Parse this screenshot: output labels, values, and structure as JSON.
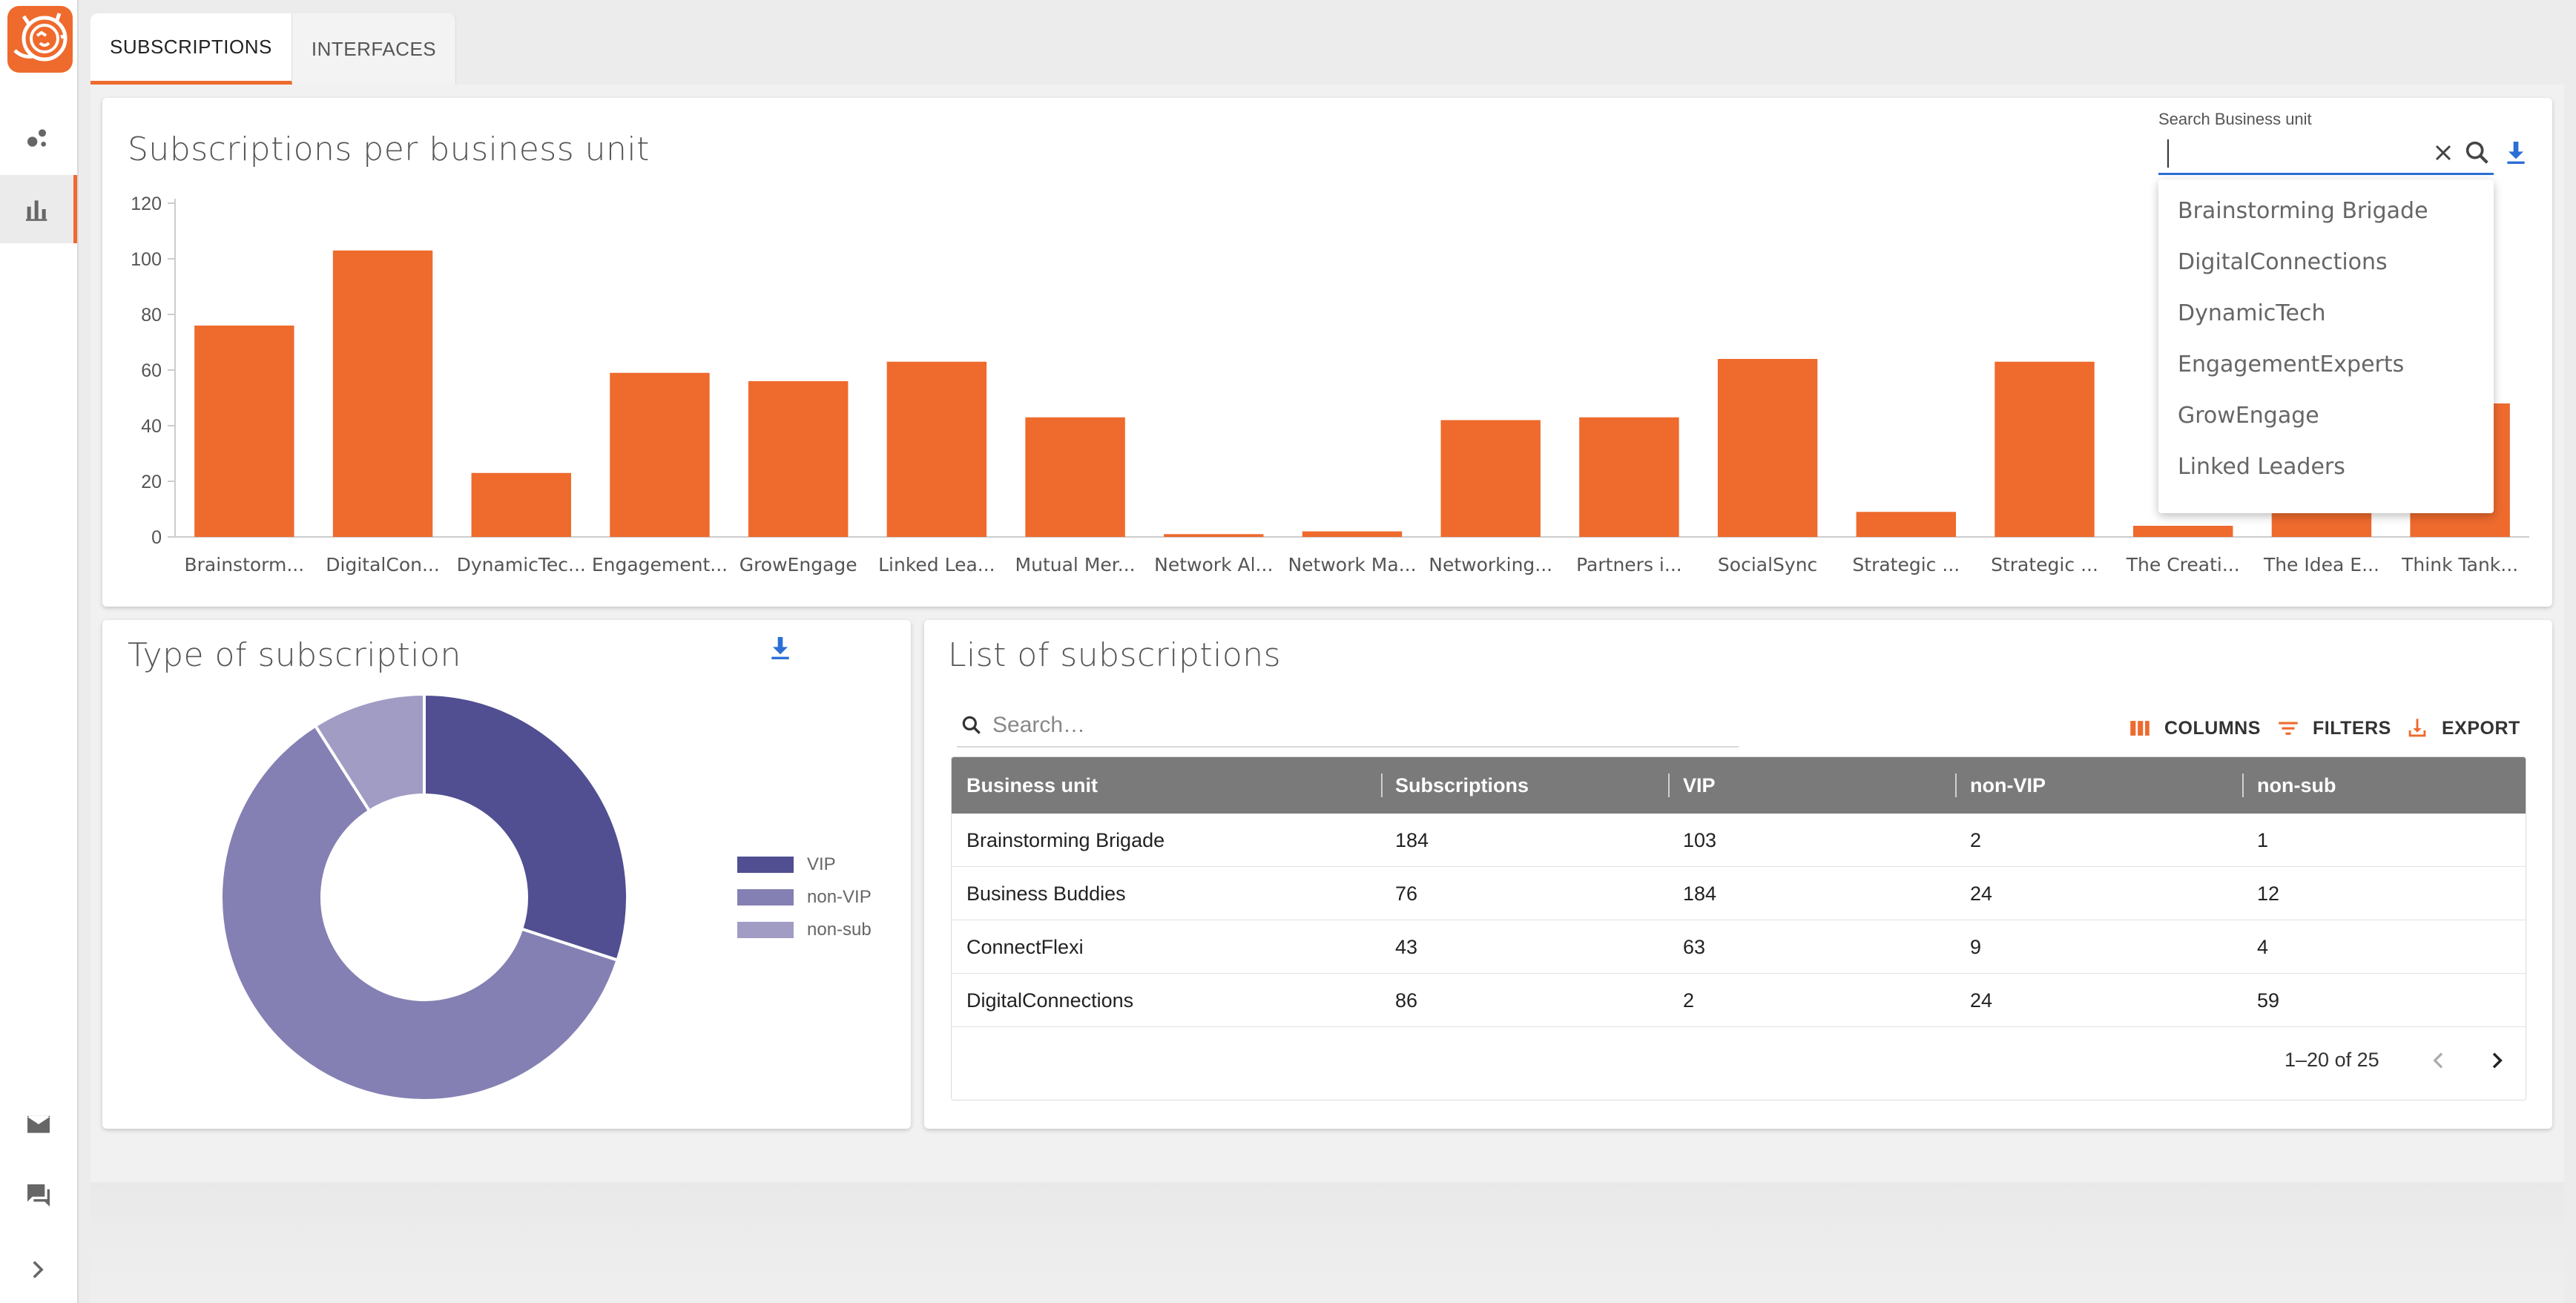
{
  "tabs": [
    {
      "label": "SUBSCRIPTIONS",
      "active": true
    },
    {
      "label": "INTERFACES",
      "active": false
    }
  ],
  "sidebar": {
    "items": [
      {
        "icon": "bubbles-icon",
        "active": false
      },
      {
        "icon": "bar-chart-icon",
        "active": true
      }
    ],
    "bottom": [
      {
        "icon": "mail-icon"
      },
      {
        "icon": "chat-icon"
      },
      {
        "icon": "chevron-right-icon"
      }
    ]
  },
  "bar_card": {
    "title": "Subscriptions per business unit"
  },
  "bu_search": {
    "label": "Search Business unit",
    "value": "",
    "options": [
      "Brainstorming Brigade",
      "DigitalConnections",
      "DynamicTech",
      "EngagementExperts",
      "GrowEngage",
      "Linked Leaders"
    ]
  },
  "donut_card": {
    "title": "Type of subscription"
  },
  "table_card": {
    "title": "List of subscriptions",
    "search_placeholder": "Search…",
    "toolbar": {
      "columns": "COLUMNS",
      "filters": "FILTERS",
      "export": "EXPORT"
    },
    "headers": [
      "Business unit",
      "Subscriptions",
      "VIP",
      "non-VIP",
      "non-sub"
    ],
    "rows": [
      [
        "Brainstorming Brigade",
        "184",
        "103",
        "2",
        "1"
      ],
      [
        "Business Buddies",
        "76",
        "184",
        "24",
        "12"
      ],
      [
        "ConnectFlexi",
        "43",
        "63",
        "9",
        "4"
      ],
      [
        "DigitalConnections",
        "86",
        "2",
        "24",
        "59"
      ]
    ],
    "pagination": "1–20 of 25"
  },
  "colors": {
    "accent": "#ee6a2d",
    "bar": "#ee6a2d",
    "vip": "#514f91",
    "non_vip": "#8480b3",
    "non_sub": "#a09cc4",
    "link_blue": "#2b6fd6"
  },
  "chart_data": [
    {
      "type": "bar",
      "title": "Subscriptions per business unit",
      "categories": [
        "Brainstorm...",
        "DigitalCon...",
        "DynamicTec...",
        "Engagement...",
        "GrowEngage",
        "Linked Lea...",
        "Mutual Mer...",
        "Network Al...",
        "Network Ma...",
        "Networking...",
        "Partners i...",
        "SocialSync",
        "Strategic ...",
        "Strategic ...",
        "The Creati...",
        "The Idea E...",
        "Think Tank..."
      ],
      "values": [
        76,
        103,
        23,
        59,
        56,
        63,
        43,
        1,
        2,
        42,
        43,
        64,
        9,
        63,
        4,
        40,
        48
      ],
      "yticks": [
        "0",
        "20",
        "40",
        "60",
        "80",
        "100",
        "120"
      ],
      "ylim": [
        0,
        120
      ],
      "grid": false
    },
    {
      "type": "pie",
      "title": "Type of subscription",
      "donut": true,
      "labels": [
        "VIP",
        "non-VIP",
        "non-sub"
      ],
      "values": [
        30,
        61,
        9
      ],
      "legend": "right"
    }
  ]
}
